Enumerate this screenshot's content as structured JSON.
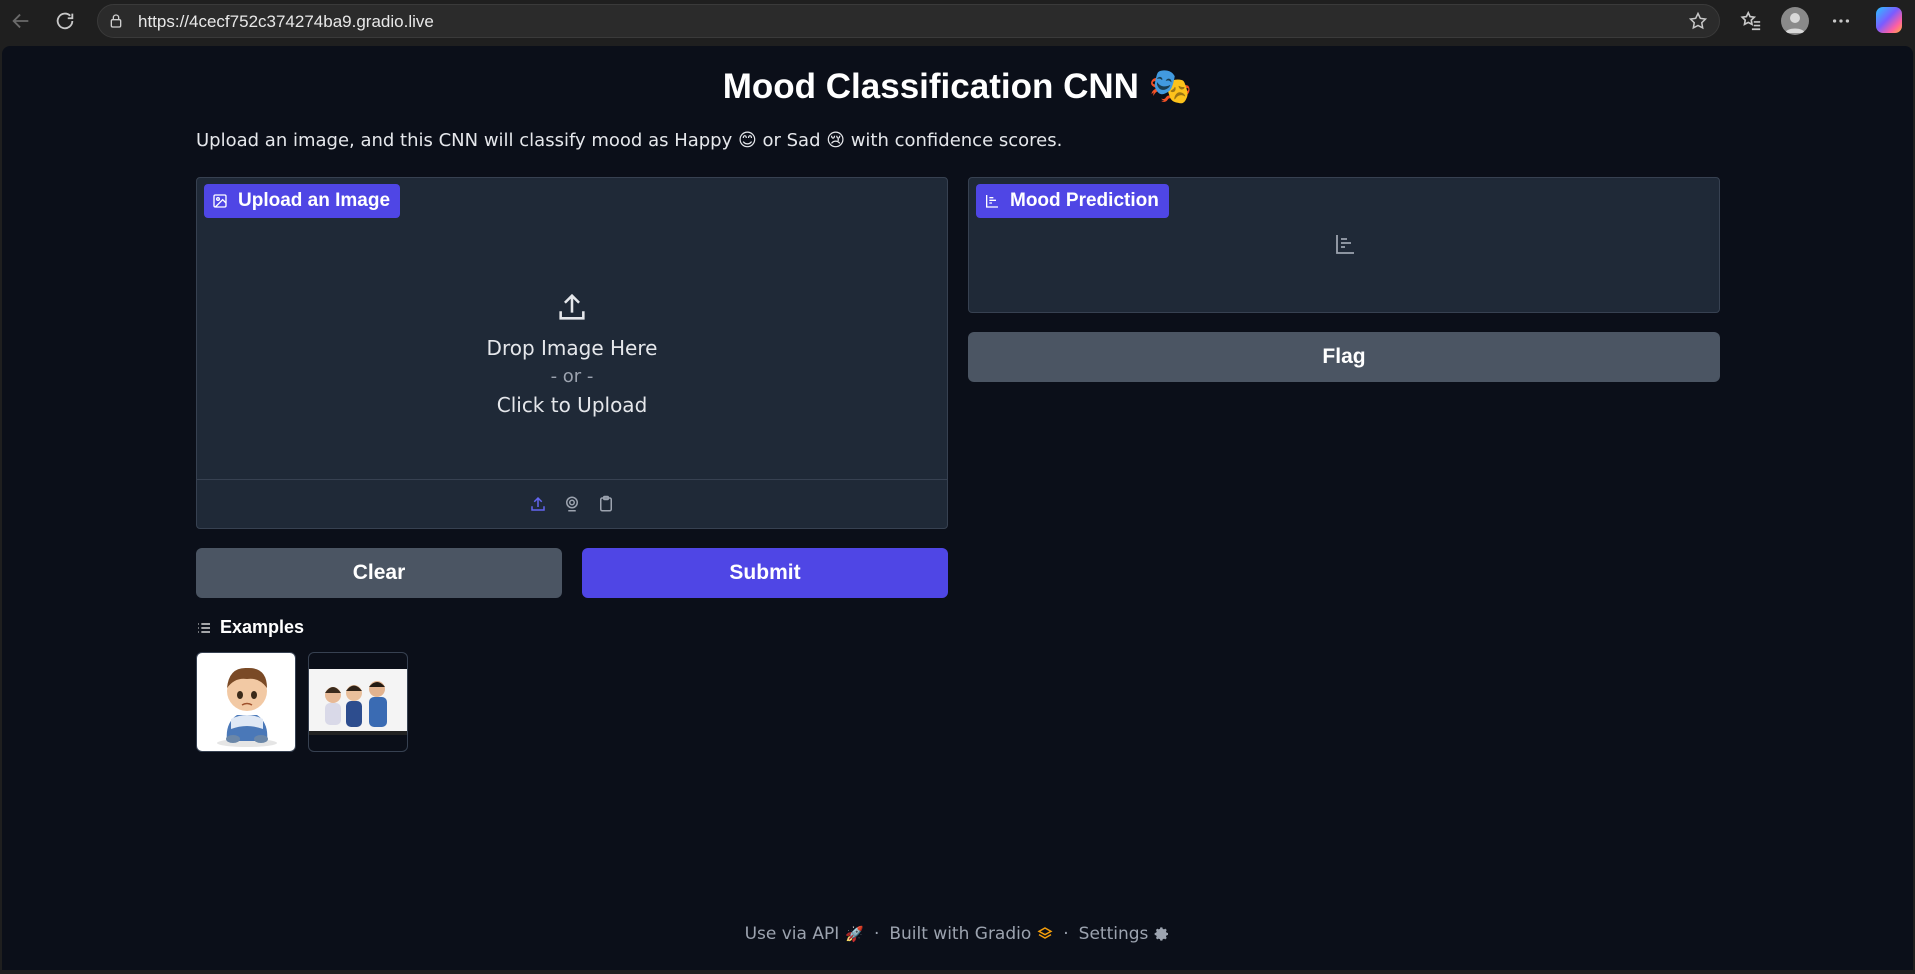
{
  "browser": {
    "url": "https://4cecf752c374274ba9.gradio.live"
  },
  "page": {
    "title": "Mood Classification CNN 🎭",
    "description": "Upload an image, and this CNN will classify mood as Happy 😊 or Sad 😢 with confidence scores."
  },
  "input_panel": {
    "label": "Upload an Image",
    "drop_text": "Drop Image Here",
    "or_text": "- or -",
    "click_text": "Click to Upload"
  },
  "output_panel": {
    "label": "Mood Prediction"
  },
  "buttons": {
    "clear": "Clear",
    "submit": "Submit",
    "flag": "Flag"
  },
  "examples": {
    "title": "Examples"
  },
  "footer": {
    "api": "Use via API",
    "built": "Built with Gradio",
    "settings": "Settings",
    "separator": "·"
  },
  "colors": {
    "accent": "#4f46e5",
    "page_bg": "#0b0f19",
    "panel_bg": "#1f2937",
    "secondary_button": "#4b5563"
  }
}
